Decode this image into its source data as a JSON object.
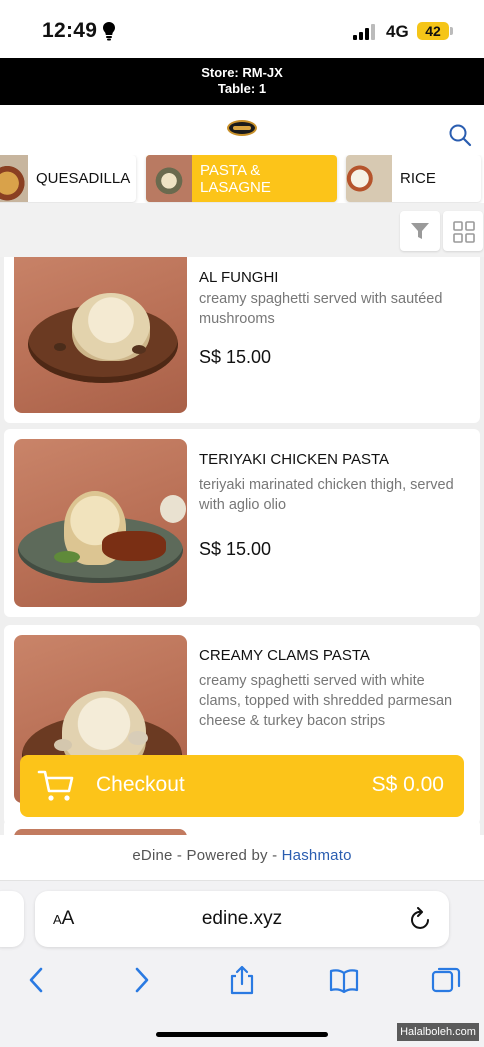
{
  "status": {
    "time": "12:49",
    "network": "4G",
    "battery": "42"
  },
  "store": {
    "line1": "Store: RM-JX",
    "line2": "Table: 1"
  },
  "categories": [
    {
      "label": "QUESADILLA"
    },
    {
      "label": "PASTA & LASAGNE",
      "active": true
    },
    {
      "label": "RICE"
    }
  ],
  "menu": [
    {
      "name": "AL FUNGHI",
      "desc": "creamy spaghetti served with sautéed mushrooms",
      "price": "S$ 15.00"
    },
    {
      "name": "TERIYAKI CHICKEN PASTA",
      "desc": "teriyaki marinated chicken thigh, served with aglio olio",
      "price": "S$ 15.00"
    },
    {
      "name": "CREAMY CLAMS PASTA",
      "desc": "creamy spaghetti served with white clams, topped with shredded parmesan cheese & turkey bacon strips",
      "price": ""
    }
  ],
  "checkout": {
    "label": "Checkout",
    "total": "S$ 0.00"
  },
  "footer": {
    "text": "eDine - Powered by - ",
    "brand": "Hashmato"
  },
  "browser": {
    "aa_small": "A",
    "aa_large": "A",
    "url": "edine.xyz"
  },
  "watermark": "Halalboleh.com",
  "colors": {
    "accent": "#fcc419",
    "banner": "#000000",
    "link": "#2a5db0"
  }
}
